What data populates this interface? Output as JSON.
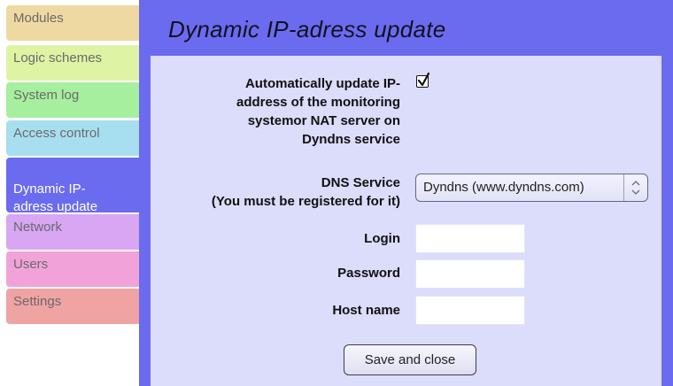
{
  "sidebar": {
    "items": [
      {
        "label": "Modules",
        "color": "#efd9a3"
      },
      {
        "label": "Logic schemes",
        "color": "#dff3a4"
      },
      {
        "label": "System log",
        "color": "#a6ef9e"
      },
      {
        "label": "Access control",
        "color": "#a8dff0"
      },
      {
        "label": "Dynamic IP-\nadress update",
        "color": "#6b6bef",
        "active": true
      },
      {
        "label": "Network",
        "color": "#d8a6f3"
      },
      {
        "label": "Users",
        "color": "#f1a3d9"
      },
      {
        "label": "Settings",
        "color": "#f0a3a3"
      }
    ]
  },
  "panel": {
    "title": "Dynamic IP-adress update"
  },
  "form": {
    "auto_update_label": "Automatically update IP-\naddress of the monitoring\nsystemor NAT server on\nDyndns service",
    "auto_update_checked": true,
    "dns_label": "DNS Service\n(You must be registered for it)",
    "dns_selected": "Dyndns (www.dyndns.com)",
    "login_label": "Login",
    "login_value": "",
    "password_label": "Password",
    "password_value": "",
    "host_label": "Host name",
    "host_value": "",
    "save_label": "Save and close"
  }
}
